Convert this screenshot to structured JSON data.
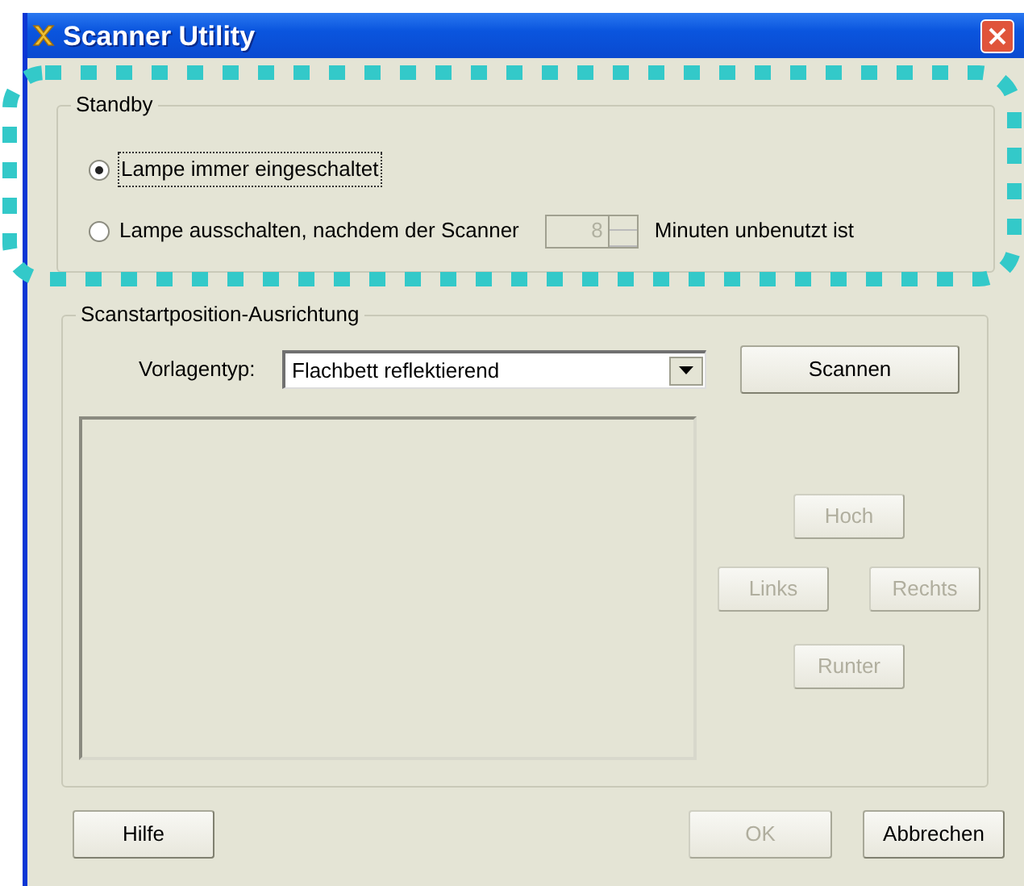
{
  "window": {
    "title": "Scanner Utility"
  },
  "standby": {
    "label": "Standby",
    "highlighted": true,
    "options": [
      {
        "label": "Lampe immer eingeschaltet",
        "selected": true,
        "focused": true
      },
      {
        "label": "Lampe ausschalten, nachdem der Scanner",
        "selected": false,
        "focused": false
      }
    ],
    "minutes": {
      "value": "8",
      "disabled": true
    },
    "suffix": "Minuten unbenutzt ist"
  },
  "alignment": {
    "label": "Scanstartposition-Ausrichtung",
    "document_type": {
      "label": "Vorlagentyp:",
      "value": "Flachbett reflektierend"
    },
    "scan_button": {
      "label": "Scannen",
      "disabled": false
    },
    "direction_buttons": [
      {
        "kind": "up",
        "label": "Hoch",
        "disabled": true
      },
      {
        "kind": "left",
        "label": "Links",
        "disabled": true
      },
      {
        "kind": "right",
        "label": "Rechts",
        "disabled": true
      },
      {
        "kind": "down",
        "label": "Runter",
        "disabled": true
      }
    ]
  },
  "buttons": [
    {
      "kind": "help",
      "label": "Hilfe",
      "disabled": false
    },
    {
      "kind": "ok",
      "label": "OK",
      "disabled": true
    },
    {
      "kind": "cancel",
      "label": "Abbrechen",
      "disabled": false
    }
  ]
}
